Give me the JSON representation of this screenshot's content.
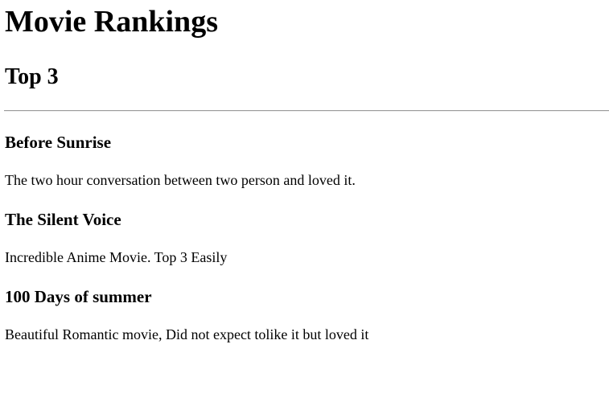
{
  "page": {
    "title": "Movie Rankings",
    "subtitle": "Top 3"
  },
  "movies": [
    {
      "title": "Before Sunrise",
      "review": "The two hour conversation between two person and loved it."
    },
    {
      "title": "The Silent Voice",
      "review": "Incredible Anime Movie. Top 3 Easily"
    },
    {
      "title": "100 Days of summer",
      "review": "Beautiful Romantic movie, Did not expect tolike it but loved it"
    }
  ]
}
